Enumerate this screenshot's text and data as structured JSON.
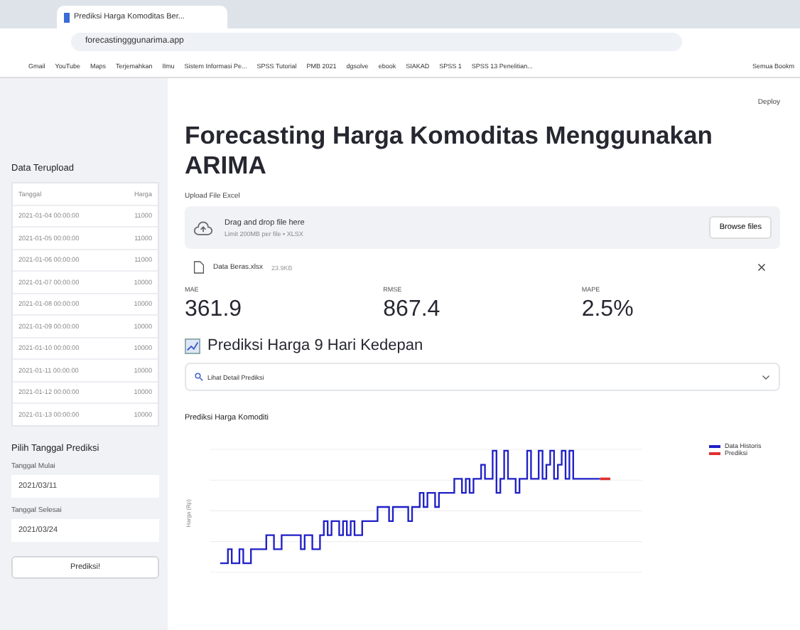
{
  "browser": {
    "tab_title": "Prediksi Harga Komoditas Ber...",
    "url": "forecastingggunarima.app",
    "bookmarks": [
      "Gmail",
      "YouTube",
      "Maps",
      "Terjemahkan",
      "Ilmu",
      "Sistem Informasi Pe...",
      "SPSS Tutorial",
      "PMB 2021",
      "dgsolve",
      "ebook",
      "SIAKAD",
      "SPSS 1",
      "SPSS 13 Penelitian..."
    ],
    "all_bookmarks": "Semua Bookm"
  },
  "sidebar": {
    "table_title": "Data Terupload",
    "columns": [
      "Tanggal",
      "Harga"
    ],
    "rows": [
      [
        "2021-01-04 00:00:00",
        "11000"
      ],
      [
        "2021-01-05 00:00:00",
        "11000"
      ],
      [
        "2021-01-06 00:00:00",
        "11000"
      ],
      [
        "2021-01-07 00:00:00",
        "10000"
      ],
      [
        "2021-01-08 00:00:00",
        "10000"
      ],
      [
        "2021-01-09 00:00:00",
        "10000"
      ],
      [
        "2021-01-10 00:00:00",
        "10000"
      ],
      [
        "2021-01-11 00:00:00",
        "10000"
      ],
      [
        "2021-01-12 00:00:00",
        "10000"
      ],
      [
        "2021-01-13 00:00:00",
        "10000"
      ]
    ],
    "date_title": "Pilih Tanggal Prediksi",
    "start_label": "Tanggal Mulai",
    "start_value": "2021/03/11",
    "end_label": "Tanggal Selesai",
    "end_value": "2021/03/24",
    "button": "Prediksi!"
  },
  "header": {
    "deploy": "Deploy"
  },
  "main": {
    "title": "Forecasting Harga Komoditas Menggunakan ARIMA",
    "upload_label": "Upload File Excel",
    "drop_text": "Drag and drop file here",
    "drop_hint": "Limit 200MB per file • XLSX",
    "browse": "Browse files",
    "file_name": "Data Beras.xlsx",
    "file_size": "23.9KB",
    "metrics": [
      {
        "label": "MAE",
        "value": "361.9"
      },
      {
        "label": "RMSE",
        "value": "867.4"
      },
      {
        "label": "MAPE",
        "value": "2.5%"
      }
    ],
    "section_title": "Prediksi Harga 9 Hari Kedepan",
    "expander": "Lihat Detail Prediksi",
    "expanded": false,
    "chart_title": "Prediksi Harga Komoditi",
    "y_label": "Harga (Rp)",
    "legend": [
      {
        "name": "Data Historis",
        "color": "#1f1fc8"
      },
      {
        "name": "Prediksi",
        "color": "#e03030"
      }
    ]
  }
}
